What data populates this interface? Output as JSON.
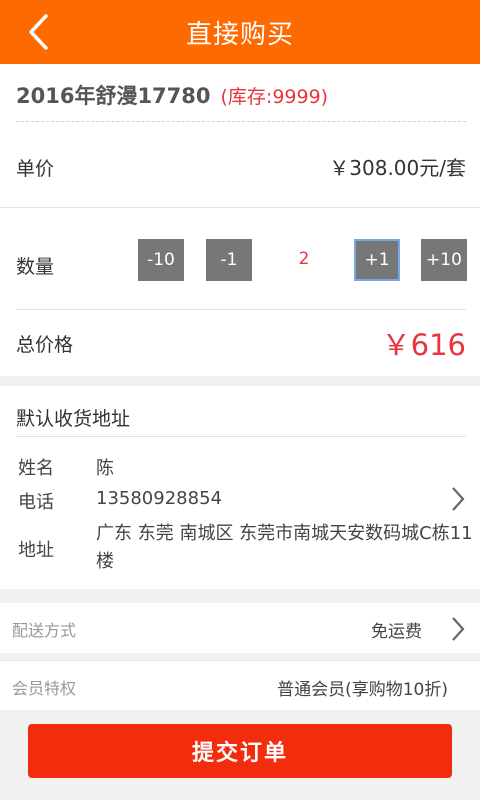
{
  "header": {
    "title": "直接购买"
  },
  "product": {
    "name": "2016年舒漫17780",
    "stock": "(库存:9999)",
    "price_label": "单价",
    "price_value": "￥308.00元/套",
    "qty_label": "数量",
    "qty_buttons": [
      "-10",
      "-1",
      "+1",
      "+10"
    ],
    "qty_value": "2",
    "total_label": "总价格",
    "total_value": "￥616"
  },
  "address": {
    "title": "默认收货地址",
    "name_label": "姓名",
    "name_value": "陈",
    "phone_label": "电话",
    "phone_value": "13580928854",
    "addr_label": "地址",
    "addr_value": "广东 东莞 南城区 东莞市南城天安数码城C栋11楼"
  },
  "delivery": {
    "label": "配送方式",
    "value": "免运费"
  },
  "member": {
    "label": "会员特权",
    "value": "普通会员(享购物10折)"
  },
  "submit": {
    "label": "提交订单"
  },
  "colors": {
    "header": "#ff6a00",
    "accent_red": "#e8353e",
    "submit": "#f32c0e",
    "qty_button": "#777777"
  }
}
